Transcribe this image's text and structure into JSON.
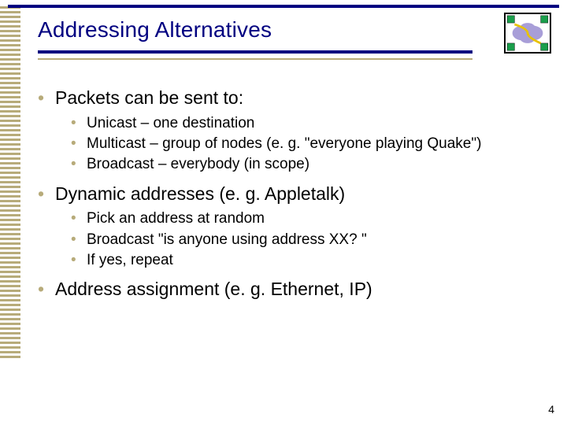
{
  "title": "Addressing Alternatives",
  "bullets": {
    "b1": "Packets can be sent to:",
    "b1_1": "Unicast – one destination",
    "b1_2": "Multicast – group of nodes (e. g. \"everyone playing Quake\")",
    "b1_3": "Broadcast – everybody (in scope)",
    "b2": "Dynamic addresses (e. g. Appletalk)",
    "b2_1": "Pick an address at random",
    "b2_2": "Broadcast \"is anyone using address XX? \"",
    "b2_3": "If yes, repeat",
    "b3": "Address assignment (e. g. Ethernet, IP)"
  },
  "page_number": "4"
}
